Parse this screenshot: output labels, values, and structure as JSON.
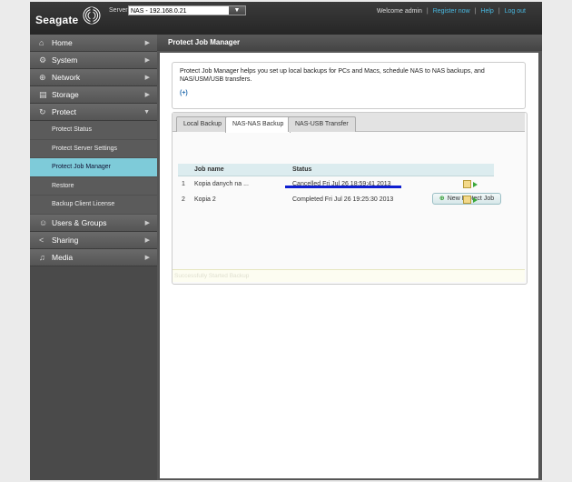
{
  "header": {
    "brand": "Seagate",
    "server_label": "Server:",
    "server_value": "NAS - 192.168.0.21",
    "welcome": "Welcome admin",
    "register": "Register now",
    "help": "Help",
    "logout": "Log out"
  },
  "sidebar": {
    "items": [
      {
        "label": "Home",
        "icon": "home-icon"
      },
      {
        "label": "System",
        "icon": "system-icon"
      },
      {
        "label": "Network",
        "icon": "network-icon"
      },
      {
        "label": "Storage",
        "icon": "storage-icon"
      },
      {
        "label": "Protect",
        "icon": "protect-icon"
      }
    ],
    "protect_sub": [
      {
        "label": "Protect Status"
      },
      {
        "label": "Protect Server Settings"
      },
      {
        "label": "Protect Job Manager"
      },
      {
        "label": "Restore"
      },
      {
        "label": "Backup Client License"
      }
    ],
    "after": [
      {
        "label": "Users & Groups",
        "icon": "users-icon"
      },
      {
        "label": "Sharing",
        "icon": "sharing-icon"
      },
      {
        "label": "Media",
        "icon": "media-icon"
      }
    ]
  },
  "main": {
    "title": "Protect Job Manager",
    "intro": "Protect Job Manager helps you set up local backups for PCs and Macs, schedule NAS to NAS backups, and NAS/USM/USB transfers.",
    "more": "(+)",
    "tabs": [
      {
        "label": "Local Backup"
      },
      {
        "label": "NAS-NAS Backup"
      },
      {
        "label": "NAS-USB Transfer"
      }
    ],
    "new_job": "New Protect Job",
    "table": {
      "headers": [
        "Job name",
        "Status"
      ],
      "rows": [
        {
          "num": "1",
          "name": "Kopia danych na ...",
          "status": "Cancelled Fri Jul 26 18:59:41 2013"
        },
        {
          "num": "2",
          "name": "Kopia 2",
          "status": "Completed Fri Jul 26 19:25:30 2013"
        }
      ]
    },
    "status_msg": "Successfully Started Backup"
  },
  "colors": {
    "active_nav": "#7ecbd9",
    "link": "#48b8e0",
    "annotation": "#0e1fd0"
  }
}
